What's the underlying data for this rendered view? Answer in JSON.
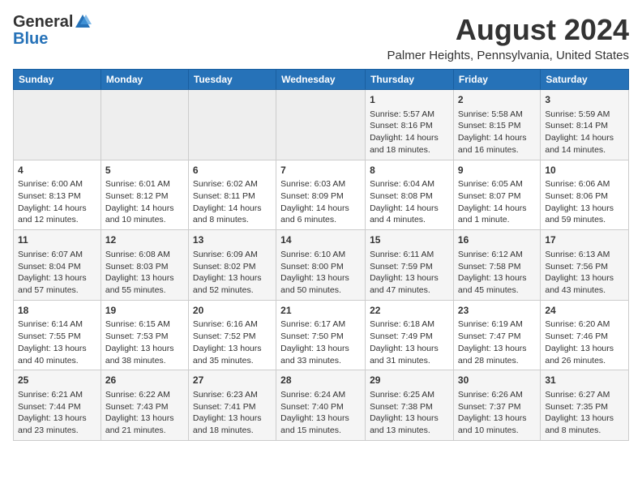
{
  "header": {
    "logo_general": "General",
    "logo_blue": "Blue",
    "main_title": "August 2024",
    "subtitle": "Palmer Heights, Pennsylvania, United States"
  },
  "days_of_week": [
    "Sunday",
    "Monday",
    "Tuesday",
    "Wednesday",
    "Thursday",
    "Friday",
    "Saturday"
  ],
  "weeks": [
    [
      {
        "day": "",
        "content": ""
      },
      {
        "day": "",
        "content": ""
      },
      {
        "day": "",
        "content": ""
      },
      {
        "day": "",
        "content": ""
      },
      {
        "day": "1",
        "content": "Sunrise: 5:57 AM\nSunset: 8:16 PM\nDaylight: 14 hours and 18 minutes."
      },
      {
        "day": "2",
        "content": "Sunrise: 5:58 AM\nSunset: 8:15 PM\nDaylight: 14 hours and 16 minutes."
      },
      {
        "day": "3",
        "content": "Sunrise: 5:59 AM\nSunset: 8:14 PM\nDaylight: 14 hours and 14 minutes."
      }
    ],
    [
      {
        "day": "4",
        "content": "Sunrise: 6:00 AM\nSunset: 8:13 PM\nDaylight: 14 hours and 12 minutes."
      },
      {
        "day": "5",
        "content": "Sunrise: 6:01 AM\nSunset: 8:12 PM\nDaylight: 14 hours and 10 minutes."
      },
      {
        "day": "6",
        "content": "Sunrise: 6:02 AM\nSunset: 8:11 PM\nDaylight: 14 hours and 8 minutes."
      },
      {
        "day": "7",
        "content": "Sunrise: 6:03 AM\nSunset: 8:09 PM\nDaylight: 14 hours and 6 minutes."
      },
      {
        "day": "8",
        "content": "Sunrise: 6:04 AM\nSunset: 8:08 PM\nDaylight: 14 hours and 4 minutes."
      },
      {
        "day": "9",
        "content": "Sunrise: 6:05 AM\nSunset: 8:07 PM\nDaylight: 14 hours and 1 minute."
      },
      {
        "day": "10",
        "content": "Sunrise: 6:06 AM\nSunset: 8:06 PM\nDaylight: 13 hours and 59 minutes."
      }
    ],
    [
      {
        "day": "11",
        "content": "Sunrise: 6:07 AM\nSunset: 8:04 PM\nDaylight: 13 hours and 57 minutes."
      },
      {
        "day": "12",
        "content": "Sunrise: 6:08 AM\nSunset: 8:03 PM\nDaylight: 13 hours and 55 minutes."
      },
      {
        "day": "13",
        "content": "Sunrise: 6:09 AM\nSunset: 8:02 PM\nDaylight: 13 hours and 52 minutes."
      },
      {
        "day": "14",
        "content": "Sunrise: 6:10 AM\nSunset: 8:00 PM\nDaylight: 13 hours and 50 minutes."
      },
      {
        "day": "15",
        "content": "Sunrise: 6:11 AM\nSunset: 7:59 PM\nDaylight: 13 hours and 47 minutes."
      },
      {
        "day": "16",
        "content": "Sunrise: 6:12 AM\nSunset: 7:58 PM\nDaylight: 13 hours and 45 minutes."
      },
      {
        "day": "17",
        "content": "Sunrise: 6:13 AM\nSunset: 7:56 PM\nDaylight: 13 hours and 43 minutes."
      }
    ],
    [
      {
        "day": "18",
        "content": "Sunrise: 6:14 AM\nSunset: 7:55 PM\nDaylight: 13 hours and 40 minutes."
      },
      {
        "day": "19",
        "content": "Sunrise: 6:15 AM\nSunset: 7:53 PM\nDaylight: 13 hours and 38 minutes."
      },
      {
        "day": "20",
        "content": "Sunrise: 6:16 AM\nSunset: 7:52 PM\nDaylight: 13 hours and 35 minutes."
      },
      {
        "day": "21",
        "content": "Sunrise: 6:17 AM\nSunset: 7:50 PM\nDaylight: 13 hours and 33 minutes."
      },
      {
        "day": "22",
        "content": "Sunrise: 6:18 AM\nSunset: 7:49 PM\nDaylight: 13 hours and 31 minutes."
      },
      {
        "day": "23",
        "content": "Sunrise: 6:19 AM\nSunset: 7:47 PM\nDaylight: 13 hours and 28 minutes."
      },
      {
        "day": "24",
        "content": "Sunrise: 6:20 AM\nSunset: 7:46 PM\nDaylight: 13 hours and 26 minutes."
      }
    ],
    [
      {
        "day": "25",
        "content": "Sunrise: 6:21 AM\nSunset: 7:44 PM\nDaylight: 13 hours and 23 minutes."
      },
      {
        "day": "26",
        "content": "Sunrise: 6:22 AM\nSunset: 7:43 PM\nDaylight: 13 hours and 21 minutes."
      },
      {
        "day": "27",
        "content": "Sunrise: 6:23 AM\nSunset: 7:41 PM\nDaylight: 13 hours and 18 minutes."
      },
      {
        "day": "28",
        "content": "Sunrise: 6:24 AM\nSunset: 7:40 PM\nDaylight: 13 hours and 15 minutes."
      },
      {
        "day": "29",
        "content": "Sunrise: 6:25 AM\nSunset: 7:38 PM\nDaylight: 13 hours and 13 minutes."
      },
      {
        "day": "30",
        "content": "Sunrise: 6:26 AM\nSunset: 7:37 PM\nDaylight: 13 hours and 10 minutes."
      },
      {
        "day": "31",
        "content": "Sunrise: 6:27 AM\nSunset: 7:35 PM\nDaylight: 13 hours and 8 minutes."
      }
    ]
  ]
}
